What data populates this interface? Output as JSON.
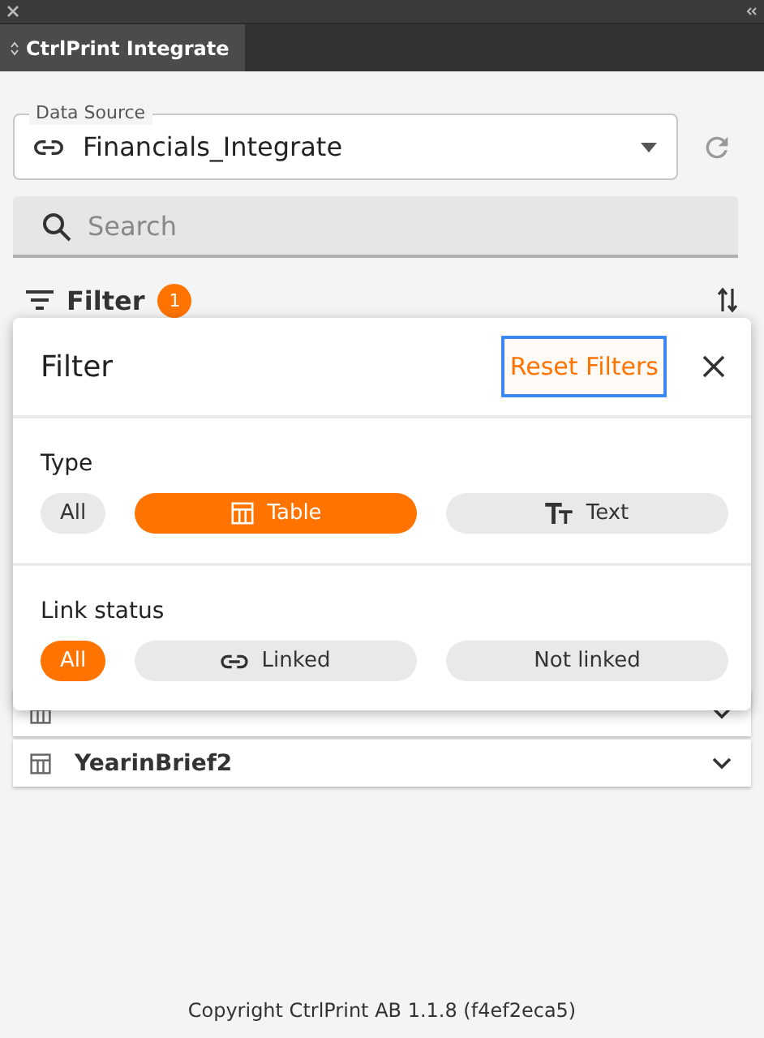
{
  "panel_tab": {
    "label": "CtrlPrint Integrate"
  },
  "data_source": {
    "label": "Data Source",
    "value": "Financials_Integrate"
  },
  "search": {
    "placeholder": "Search"
  },
  "filter_bar": {
    "label": "Filter",
    "count": "1"
  },
  "filter_popup": {
    "title": "Filter",
    "reset_button": "Reset Filters",
    "sections": [
      {
        "title": "Type",
        "chips": [
          {
            "label": "All",
            "kind": "plain",
            "selected": false
          },
          {
            "label": "Table",
            "kind": "table",
            "selected": true
          },
          {
            "label": "Text",
            "kind": "text",
            "selected": false
          }
        ]
      },
      {
        "title": "Link status",
        "chips": [
          {
            "label": "All",
            "kind": "plain",
            "selected": true
          },
          {
            "label": "Linked",
            "kind": "link",
            "selected": false
          },
          {
            "label": "Not linked",
            "kind": "plain",
            "selected": false
          }
        ]
      }
    ]
  },
  "items": [
    {
      "name": "YearinBrief2"
    }
  ],
  "footer": "Copyright CtrlPrint AB 1.1.8 (f4ef2eca5)"
}
